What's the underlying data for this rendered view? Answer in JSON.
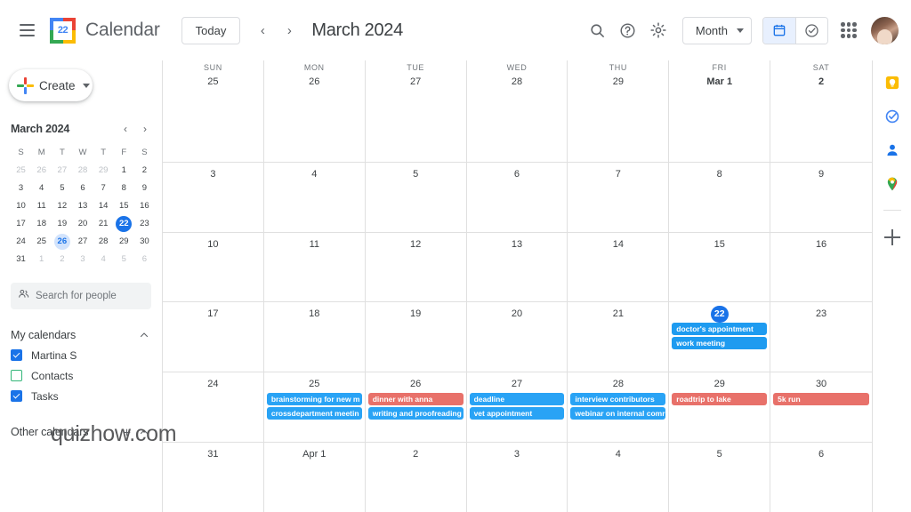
{
  "app": {
    "brand": "Calendar",
    "logo_day": "22",
    "watermark": "quizhow.com"
  },
  "topbar": {
    "menu_icon": "hamburger-icon",
    "today_label": "Today",
    "prev_label": "‹",
    "next_label": "›",
    "period_label": "March 2024",
    "search_icon": "search-icon",
    "help_icon": "help-icon",
    "settings_icon": "gear-icon",
    "view_label": "Month",
    "calendar_toggle_icon": "calendar-icon",
    "tasks_toggle_icon": "check-circle-icon",
    "apps_icon": "apps-grid-icon",
    "avatar_icon": "avatar"
  },
  "sidebar": {
    "create_label": "Create",
    "mini_calendar": {
      "title": "March 2024",
      "prev": "‹",
      "next": "›",
      "dow": [
        "S",
        "M",
        "T",
        "W",
        "T",
        "F",
        "S"
      ],
      "weeks": [
        [
          {
            "d": "25",
            "muted": true
          },
          {
            "d": "26",
            "muted": true
          },
          {
            "d": "27",
            "muted": true
          },
          {
            "d": "28",
            "muted": true
          },
          {
            "d": "29",
            "muted": true
          },
          {
            "d": "1"
          },
          {
            "d": "2"
          }
        ],
        [
          {
            "d": "3"
          },
          {
            "d": "4"
          },
          {
            "d": "5"
          },
          {
            "d": "6"
          },
          {
            "d": "7"
          },
          {
            "d": "8"
          },
          {
            "d": "9"
          }
        ],
        [
          {
            "d": "10"
          },
          {
            "d": "11"
          },
          {
            "d": "12"
          },
          {
            "d": "13"
          },
          {
            "d": "14"
          },
          {
            "d": "15"
          },
          {
            "d": "16"
          }
        ],
        [
          {
            "d": "17"
          },
          {
            "d": "18"
          },
          {
            "d": "19"
          },
          {
            "d": "20"
          },
          {
            "d": "21"
          },
          {
            "d": "22",
            "today": true
          },
          {
            "d": "23"
          }
        ],
        [
          {
            "d": "24"
          },
          {
            "d": "25"
          },
          {
            "d": "26",
            "sel": true
          },
          {
            "d": "27"
          },
          {
            "d": "28"
          },
          {
            "d": "29"
          },
          {
            "d": "30"
          }
        ],
        [
          {
            "d": "31"
          },
          {
            "d": "1",
            "muted": true
          },
          {
            "d": "2",
            "muted": true
          },
          {
            "d": "3",
            "muted": true
          },
          {
            "d": "4",
            "muted": true
          },
          {
            "d": "5",
            "muted": true
          },
          {
            "d": "6",
            "muted": true
          }
        ]
      ]
    },
    "people_search_placeholder": "Search for people",
    "people_search_value": "",
    "people_icon": "people-icon",
    "my_calendars": {
      "title": "My calendars",
      "collapse_icon": "chevron-up-icon",
      "items": [
        {
          "label": "Martina S",
          "checked": true,
          "color": "#1a73e8"
        },
        {
          "label": "Contacts",
          "checked": false,
          "color": "#33b679"
        },
        {
          "label": "Tasks",
          "checked": true,
          "color": "#1a73e8"
        }
      ]
    },
    "other_calendars": {
      "title": "Other calendars",
      "add_icon": "plus-icon",
      "collapse_icon": "chevron-up-icon"
    }
  },
  "grid": {
    "dow": [
      "SUN",
      "MON",
      "TUE",
      "WED",
      "THU",
      "FRI",
      "SAT"
    ],
    "weeks": [
      {
        "days": [
          {
            "label": "25",
            "events": []
          },
          {
            "label": "26",
            "events": []
          },
          {
            "label": "27",
            "events": []
          },
          {
            "label": "28",
            "events": []
          },
          {
            "label": "29",
            "events": []
          },
          {
            "label": "Mar 1",
            "bold": true,
            "events": []
          },
          {
            "label": "2",
            "bold": true,
            "events": []
          }
        ]
      },
      {
        "days": [
          {
            "label": "3",
            "events": []
          },
          {
            "label": "4",
            "events": []
          },
          {
            "label": "5",
            "events": []
          },
          {
            "label": "6",
            "events": []
          },
          {
            "label": "7",
            "events": []
          },
          {
            "label": "8",
            "events": []
          },
          {
            "label": "9",
            "events": []
          }
        ]
      },
      {
        "days": [
          {
            "label": "10",
            "events": []
          },
          {
            "label": "11",
            "events": []
          },
          {
            "label": "12",
            "events": []
          },
          {
            "label": "13",
            "events": []
          },
          {
            "label": "14",
            "events": []
          },
          {
            "label": "15",
            "events": []
          },
          {
            "label": "16",
            "events": []
          }
        ]
      },
      {
        "days": [
          {
            "label": "17",
            "events": []
          },
          {
            "label": "18",
            "events": []
          },
          {
            "label": "19",
            "events": []
          },
          {
            "label": "20",
            "events": []
          },
          {
            "label": "21",
            "events": []
          },
          {
            "label": "22",
            "today": true,
            "events": [
              {
                "title": "doctor's appointment",
                "color": "#1e9bf0"
              },
              {
                "title": "work meeting",
                "color": "#1e9bf0"
              }
            ]
          },
          {
            "label": "23",
            "events": []
          }
        ]
      },
      {
        "days": [
          {
            "label": "24",
            "events": []
          },
          {
            "label": "25",
            "events": [
              {
                "title": "brainstorming for new m",
                "color": "#29a3f5"
              },
              {
                "title": "crossdepartment meetin",
                "color": "#29a3f5"
              }
            ]
          },
          {
            "label": "26",
            "events": [
              {
                "title": "dinner with anna",
                "color": "#e8716a"
              },
              {
                "title": "writing and proofreading",
                "color": "#29a3f5"
              }
            ]
          },
          {
            "label": "27",
            "events": [
              {
                "title": "deadline",
                "color": "#29a3f5"
              },
              {
                "title": "vet appointment",
                "color": "#29a3f5"
              }
            ]
          },
          {
            "label": "28",
            "events": [
              {
                "title": "interview contributors",
                "color": "#29a3f5"
              },
              {
                "title": "webinar on internal comr",
                "color": "#29a3f5"
              }
            ]
          },
          {
            "label": "29",
            "events": [
              {
                "title": "roadtrip to lake",
                "color": "#e8716a"
              }
            ]
          },
          {
            "label": "30",
            "events": [
              {
                "title": "5k run",
                "color": "#e8716a"
              }
            ]
          }
        ]
      },
      {
        "days": [
          {
            "label": "31",
            "events": []
          },
          {
            "label": "Apr 1",
            "events": []
          },
          {
            "label": "2",
            "events": []
          },
          {
            "label": "3",
            "events": []
          },
          {
            "label": "4",
            "events": []
          },
          {
            "label": "5",
            "events": []
          },
          {
            "label": "6",
            "events": []
          }
        ]
      }
    ]
  },
  "rail": {
    "items": [
      {
        "name": "keep-icon"
      },
      {
        "name": "tasks-icon"
      },
      {
        "name": "contacts-icon"
      },
      {
        "name": "maps-icon"
      }
    ],
    "add_label": "+"
  },
  "colors": {
    "accent": "#1a73e8",
    "event_blue": "#29a3f5",
    "event_red": "#e8716a",
    "border": "#e0e0e0"
  }
}
